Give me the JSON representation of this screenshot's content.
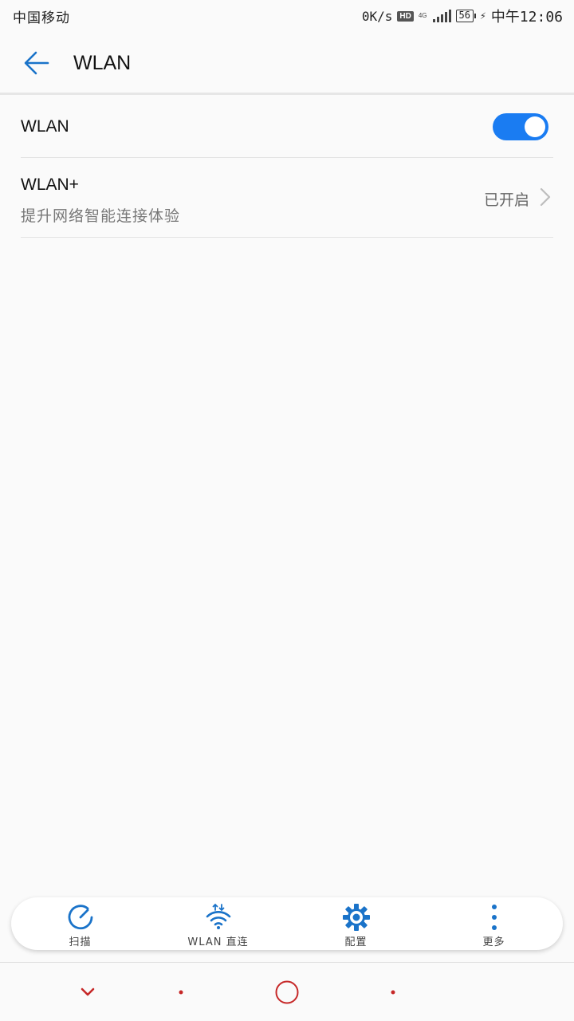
{
  "status_bar": {
    "carrier": "中国移动",
    "speed": "0K/s",
    "hd": "HD",
    "network": "4G",
    "battery": "56",
    "time": "中午12:06"
  },
  "header": {
    "title": "WLAN"
  },
  "settings": {
    "wlan_label": "WLAN",
    "wlan_enabled": true,
    "wlan_plus_label": "WLAN+",
    "wlan_plus_subtitle": "提升网络智能连接体验",
    "wlan_plus_status": "已开启"
  },
  "action_bar": {
    "scan": "扫描",
    "direct": "WLAN 直连",
    "config": "配置",
    "more": "更多"
  },
  "colors": {
    "accent": "#1a7cf2",
    "icon_blue": "#1a73c9",
    "nav_red": "#c62828"
  },
  "icons": {
    "back": "arrow-left-icon",
    "chevron": "chevron-right-icon",
    "scan": "scan-icon",
    "direct": "wifi-direct-icon",
    "config": "gear-icon",
    "more": "more-vertical-icon",
    "nav_back": "chevron-down-icon",
    "nav_home": "home-circle-icon"
  }
}
